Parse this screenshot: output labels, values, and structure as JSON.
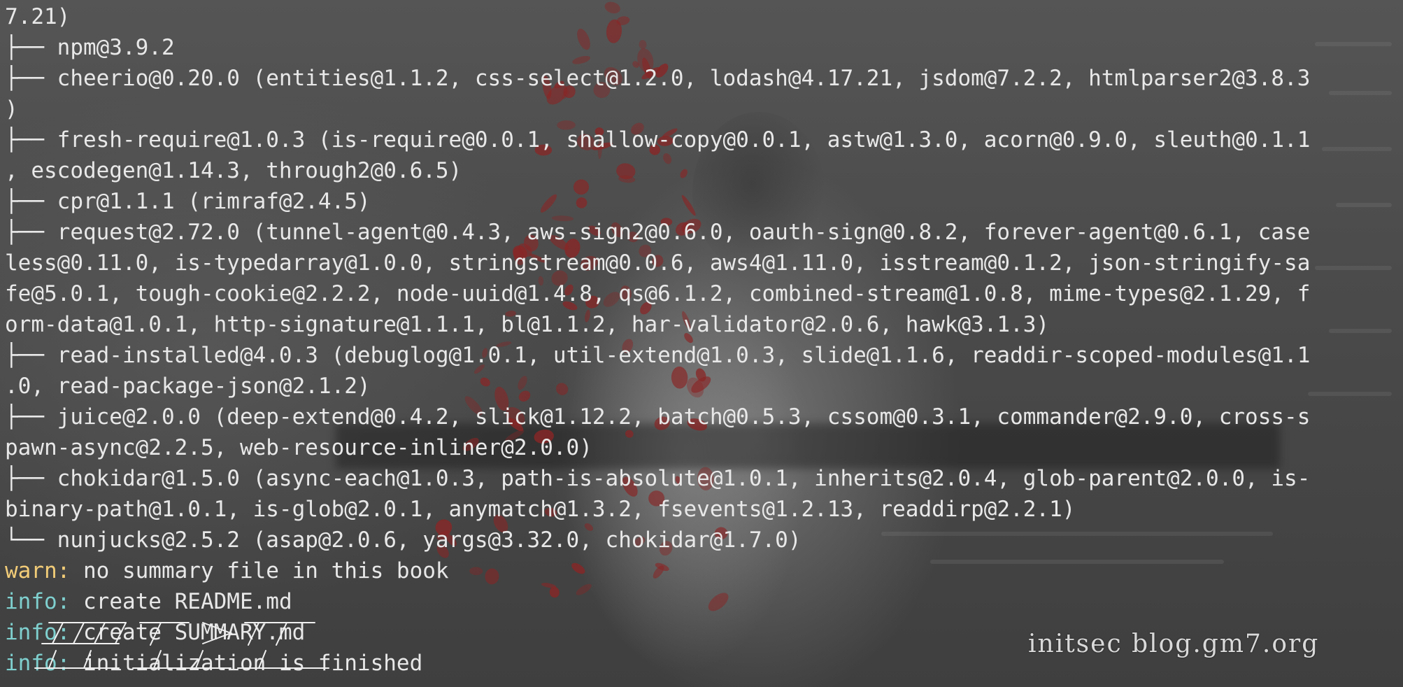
{
  "terminal": {
    "lines": [
      {
        "text": "7.21)"
      },
      {
        "text": "├── npm@3.9.2"
      },
      {
        "text": "├── cheerio@0.20.0 (entities@1.1.2, css-select@1.2.0, lodash@4.17.21, jsdom@7.2.2, htmlparser2@3.8.3"
      },
      {
        "text": ")"
      },
      {
        "text": "├── fresh-require@1.0.3 (is-require@0.0.1, shallow-copy@0.0.1, astw@1.3.0, acorn@0.9.0, sleuth@0.1.1"
      },
      {
        "text": ", escodegen@1.14.3, through2@0.6.5)"
      },
      {
        "text": "├── cpr@1.1.1 (rimraf@2.4.5)"
      },
      {
        "text": "├── request@2.72.0 (tunnel-agent@0.4.3, aws-sign2@0.6.0, oauth-sign@0.8.2, forever-agent@0.6.1, case"
      },
      {
        "text": "less@0.11.0, is-typedarray@1.0.0, stringstream@0.0.6, aws4@1.11.0, isstream@0.1.2, json-stringify-sa"
      },
      {
        "text": "fe@5.0.1, tough-cookie@2.2.2, node-uuid@1.4.8, qs@6.1.2, combined-stream@1.0.8, mime-types@2.1.29, f"
      },
      {
        "text": "orm-data@1.0.1, http-signature@1.1.1, bl@1.1.2, har-validator@2.0.6, hawk@3.1.3)"
      },
      {
        "text": "├── read-installed@4.0.3 (debuglog@1.0.1, util-extend@1.0.3, slide@1.1.6, readdir-scoped-modules@1.1"
      },
      {
        "text": ".0, read-package-json@2.1.2)"
      },
      {
        "text": "├── juice@2.0.0 (deep-extend@0.4.2, slick@1.12.2, batch@0.5.3, cssom@0.3.1, commander@2.9.0, cross-s"
      },
      {
        "text": "pawn-async@2.2.5, web-resource-inliner@2.0.0)"
      },
      {
        "text": "├── chokidar@1.5.0 (async-each@1.0.3, path-is-absolute@1.0.1, inherits@2.0.4, glob-parent@2.0.0, is-"
      },
      {
        "text": "binary-path@1.0.1, is-glob@2.0.1, anymatch@1.3.2, fsevents@1.2.13, readdirp@2.2.1)"
      },
      {
        "text": "└── nunjucks@2.5.2 (asap@2.0.6, yargs@3.32.0, chokidar@1.7.0)"
      },
      {
        "prefix": "warn:",
        "level": "warn",
        "text": " no summary file in this book"
      },
      {
        "prefix": "info:",
        "level": "info",
        "text": " create README.md"
      },
      {
        "prefix": "info:",
        "level": "info",
        "text": " create SUMMARY.md"
      },
      {
        "prefix": "info:",
        "level": "info",
        "text": " initialization is finished"
      }
    ]
  },
  "watermark": "initsec blog.gm7.org",
  "colors": {
    "text": "#e8e8e8",
    "warn": "#f2cc78",
    "info": "#7fd0cf",
    "background": "#4a4a4a",
    "petal": "#8a2525"
  }
}
